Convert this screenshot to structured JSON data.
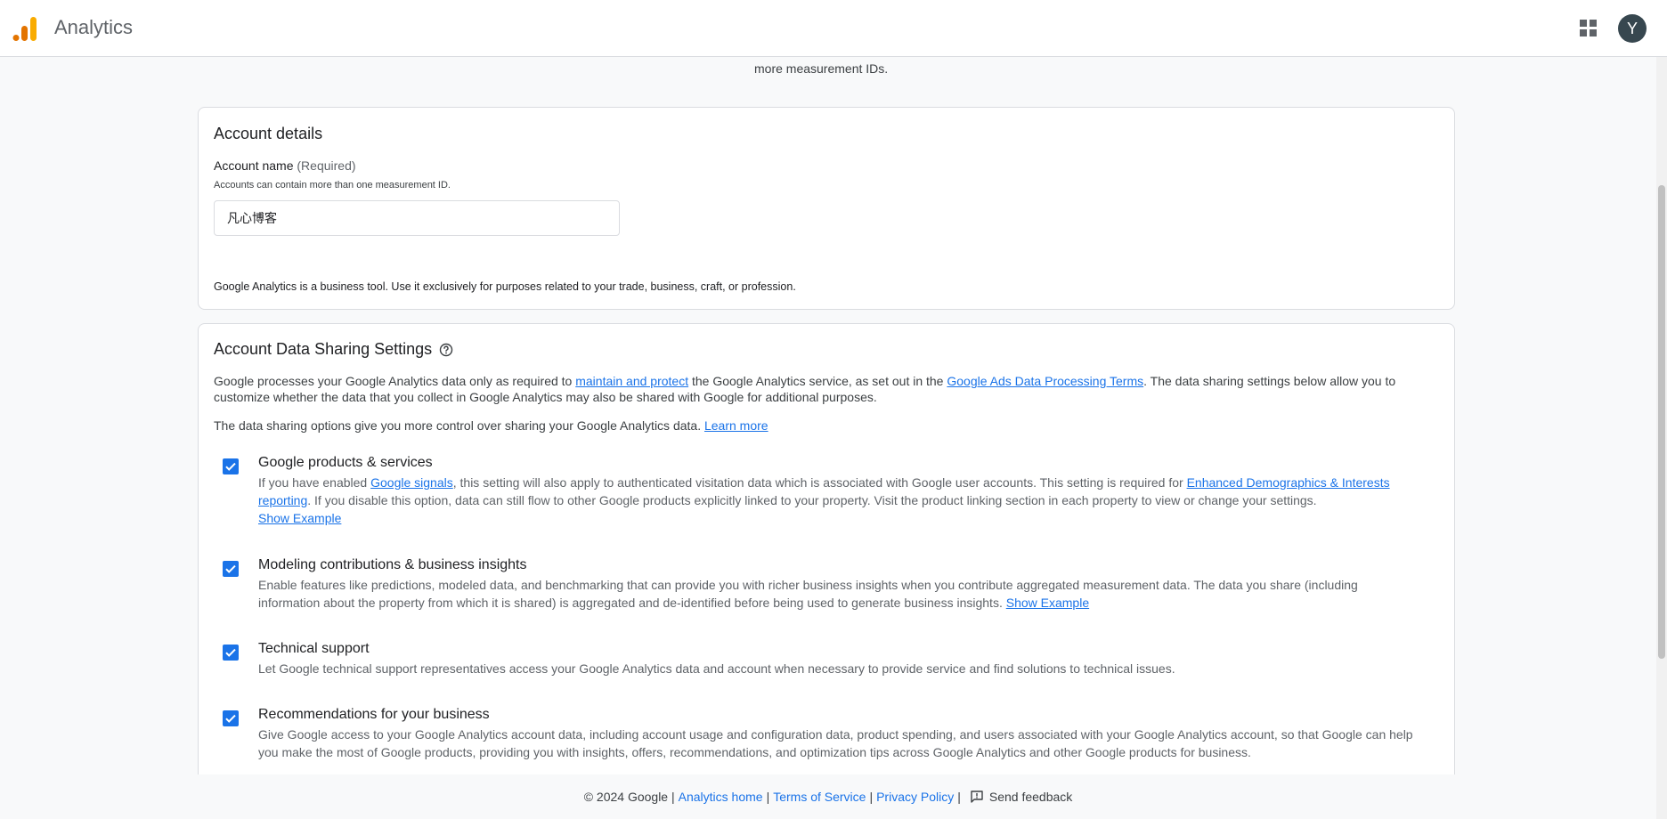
{
  "header": {
    "app_title": "Analytics",
    "avatar_initial": "Y",
    "logo_colors": [
      "#e37400",
      "#f9ab00",
      "#f9ab00"
    ]
  },
  "top_hint": "more measurement IDs.",
  "account_details": {
    "title": "Account details",
    "field_label": "Account name",
    "field_required": "(Required)",
    "field_help": "Accounts can contain more than one measurement ID.",
    "field_value": "凡心博客",
    "business_note": "Google Analytics is a business tool. Use it exclusively for purposes related to your trade, business, craft, or profession."
  },
  "sharing": {
    "title": "Account Data Sharing Settings",
    "intro": {
      "t1": "Google processes your Google Analytics data only as required to ",
      "link1": "maintain and protect",
      "t2": " the Google Analytics service, as set out in the ",
      "link2": "Google Ads Data Processing Terms",
      "t3": ". The data sharing settings below allow you to customize whether the data that you collect in Google Analytics may also be shared with Google for additional purposes."
    },
    "control": {
      "text": "The data sharing options give you more control over sharing your Google Analytics data. ",
      "link": "Learn more"
    },
    "options": [
      {
        "title": "Google products & services",
        "d1": "If you have enabled ",
        "link1": "Google signals",
        "d2": ", this setting will also apply to authenticated visitation data which is associated with Google user accounts. This setting is required for ",
        "link2": "Enhanced Demographics & Interests reporting",
        "d3": ". If you disable this option, data can still flow to other Google products explicitly linked to your property. Visit the product linking section in each property to view or change your settings.",
        "example": "Show Example",
        "checked": true
      },
      {
        "title": "Modeling contributions & business insights",
        "d1": "Enable features like predictions, modeled data, and benchmarking that can provide you with richer business insights when you contribute aggregated measurement data. The data you share (including information about the property from which it is shared) is aggregated and de-identified before being used to generate business insights. ",
        "example": "Show Example",
        "checked": true
      },
      {
        "title": "Technical support",
        "d1": "Let Google technical support representatives access your Google Analytics data and account when necessary to provide service and find solutions to technical issues.",
        "checked": true
      },
      {
        "title": "Recommendations for your business",
        "d1": "Give Google access to your Google Analytics account data, including account usage and configuration data, product spending, and users associated with your Google Analytics account, so that Google can help you make the most of Google products, providing you with insights, offers, recommendations, and optimization tips across Google Analytics and other Google products for business.",
        "checked": true
      }
    ]
  },
  "footer": {
    "copyright": "© 2024 Google |",
    "home": "Analytics home",
    "sep": "|",
    "terms": "Terms of Service",
    "privacy": "Privacy Policy",
    "feedback": "Send feedback"
  },
  "colors": {
    "accent": "#1a73e8",
    "avatar_bg": "#37474f"
  }
}
